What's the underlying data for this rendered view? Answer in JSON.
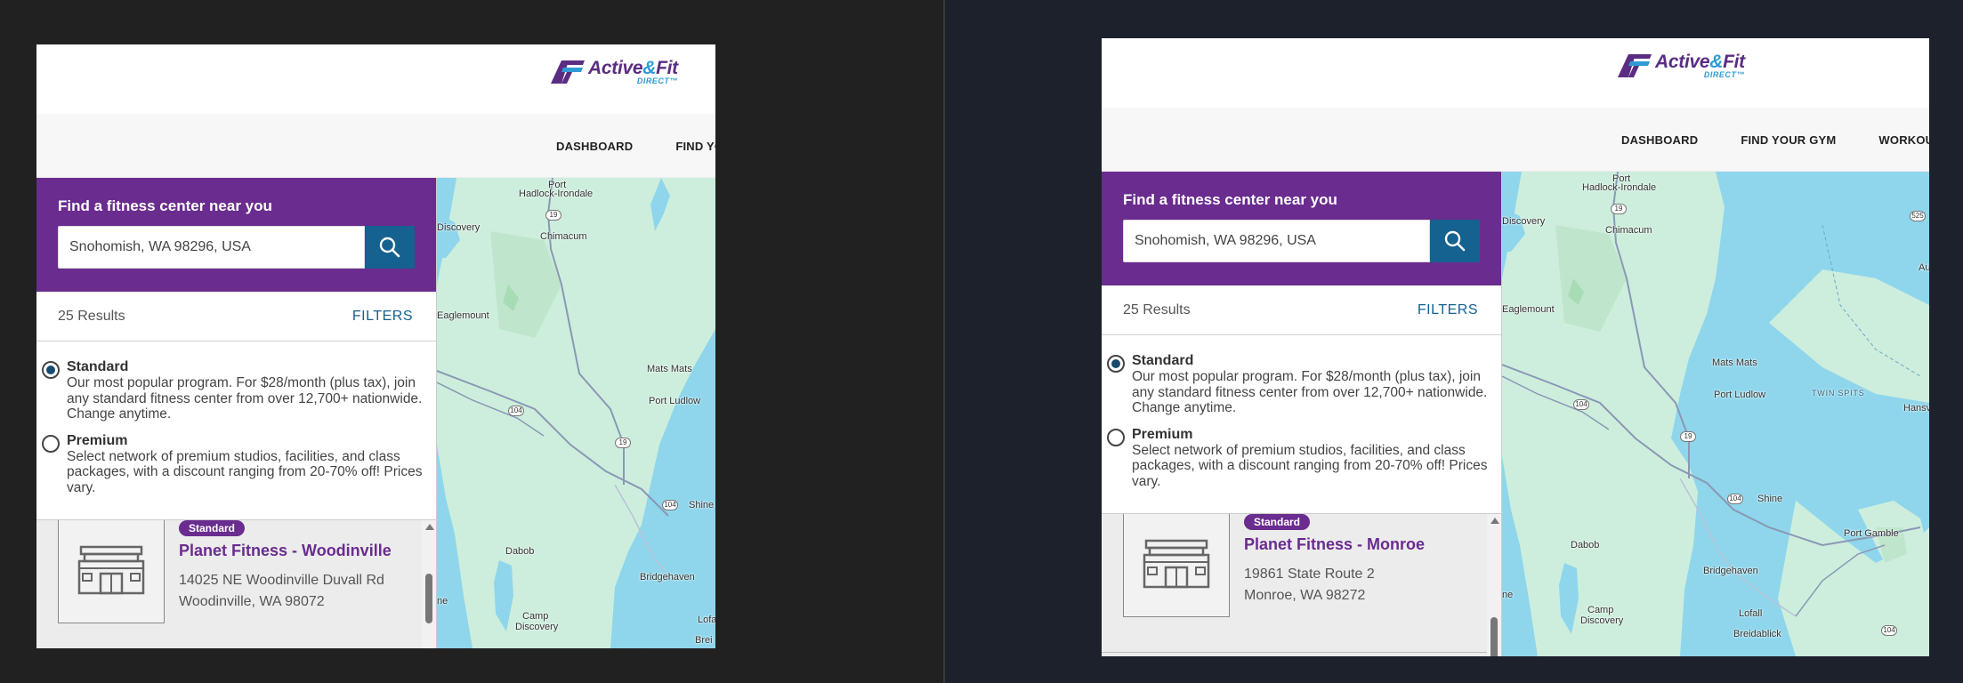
{
  "logo": {
    "word_left": "Active",
    "amp": "&",
    "word_right": "Fit",
    "sub": "DIRECT™"
  },
  "left": {
    "nav": [
      "DASHBOARD",
      "FIND YOUR GYM"
    ],
    "search": {
      "title": "Find a fitness center near you",
      "value": "Snohomish, WA 98296, USA"
    },
    "results_count": "25 Results",
    "filters_label": "FILTERS",
    "programs": [
      {
        "name": "Standard",
        "desc": "Our most popular program. For $28/month (plus tax), join any standard fitness center from over 12,700+ nationwide. Change anytime.",
        "checked": true
      },
      {
        "name": "Premium",
        "desc": "Select network of premium studios, facilities, and class packages, with a discount ranging from 20-70% off! Prices vary.",
        "checked": false
      }
    ],
    "gym": {
      "badge": "Standard",
      "name": "Planet Fitness - Woodinville",
      "address1": "14025 NE Woodinville Duvall Rd",
      "address2": "Woodinville, WA 98072"
    },
    "map_labels": [
      "Port",
      "Hadlock-Irondale",
      "Discovery",
      "Chimacum",
      "Eaglemount",
      "Mats Mats",
      "Port Ludlow",
      "Shine",
      "Dabob",
      "Bridgehaven",
      "Camp",
      "Discovery",
      "ne",
      "Lofa",
      "Brei"
    ],
    "routes": [
      "19",
      "104",
      "19",
      "104"
    ]
  },
  "right": {
    "nav": [
      "DASHBOARD",
      "FIND YOUR GYM",
      "WORKOUTS"
    ],
    "search": {
      "title": "Find a fitness center near you",
      "value": "Snohomish, WA 98296, USA"
    },
    "results_count": "25 Results",
    "filters_label": "FILTERS",
    "programs": [
      {
        "name": "Standard",
        "desc": "Our most popular program. For $28/month (plus tax), join any standard fitness center from over 12,700+ nationwide. Change anytime.",
        "checked": true
      },
      {
        "name": "Premium",
        "desc": "Select network of premium studios, facilities, and class packages, with a discount ranging from 20-70% off! Prices vary.",
        "checked": false
      }
    ],
    "gym": {
      "badge": "Standard",
      "name": "Planet Fitness - Monroe",
      "address1": "19861 State Route 2",
      "address2": "Monroe, WA 98272"
    },
    "map_labels": [
      "Port",
      "Hadlock-Irondale",
      "Discovery",
      "Chimacum",
      "Eaglemount",
      "Mats Mats",
      "Port Ludlow",
      "TWIN SPITS",
      "Hansvill",
      "Shine",
      "Port Gamble",
      "Dabob",
      "Bridgehaven",
      "Camp",
      "Discovery",
      "Lofall",
      "Breidablick",
      "ne",
      "Au"
    ],
    "routes": [
      "19",
      "104",
      "19",
      "104",
      "525",
      "104"
    ]
  },
  "colors": {
    "brand_purple": "#6a2c8f",
    "search_blue": "#15618f",
    "logo_blue": "#2e9bd6"
  }
}
